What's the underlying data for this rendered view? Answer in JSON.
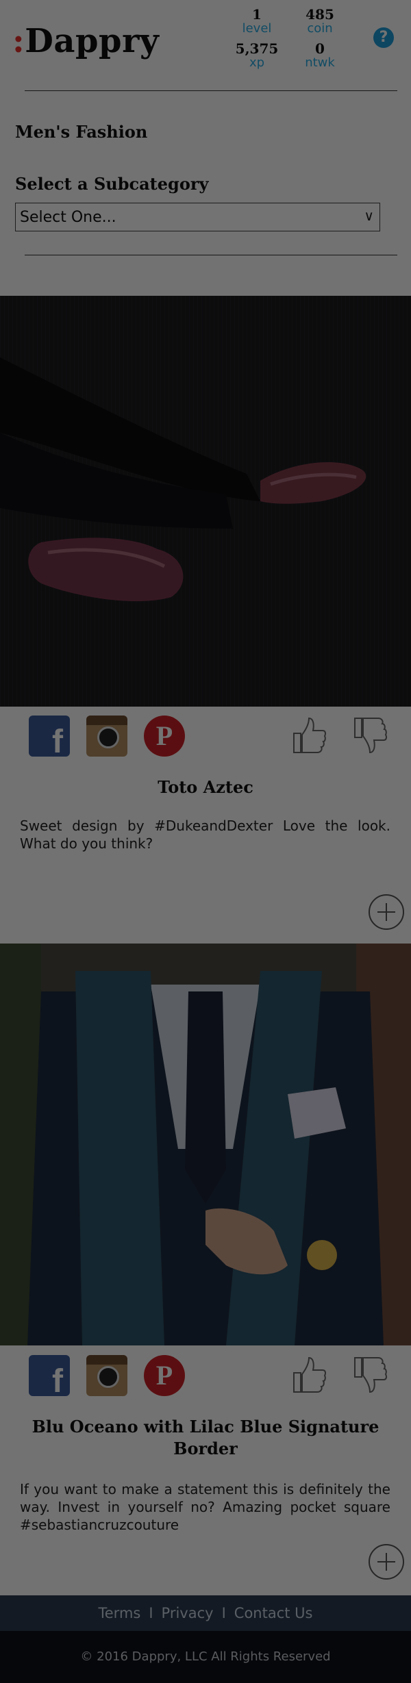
{
  "brand": {
    "colon": ":",
    "name": "Dappry"
  },
  "stats": [
    {
      "value": "1",
      "label": "level"
    },
    {
      "value": "485",
      "label": "coin"
    },
    {
      "value": "5,375",
      "label": "xp"
    },
    {
      "value": "0",
      "label": "ntwk"
    }
  ],
  "help_icon": "question-circle-icon",
  "category_title": "Men's Fashion",
  "subcategory": {
    "heading": "Select a Subcategory",
    "selected": "Select One..."
  },
  "posts": [
    {
      "title": "Toto Aztec",
      "text": "Sweet design by #DukeandDexter Love the look. What do you think?"
    },
    {
      "title": "Blu Oceano with Lilac Blue Signature Border",
      "text": "If you want to make a statement this is definitely the way. Invest in yourself no? Amazing pocket square #sebastiancruzcouture"
    }
  ],
  "footer": {
    "links": [
      "Terms",
      "Privacy",
      "Contact Us"
    ],
    "copyright": "© 2016 Dappry, LLC All Rights Reserved"
  },
  "colors": {
    "accent": "#27a9e1",
    "brand_red": "#e5312d",
    "footer_nav": "#2b3a4f",
    "footer_bottom": "#0c1019"
  }
}
